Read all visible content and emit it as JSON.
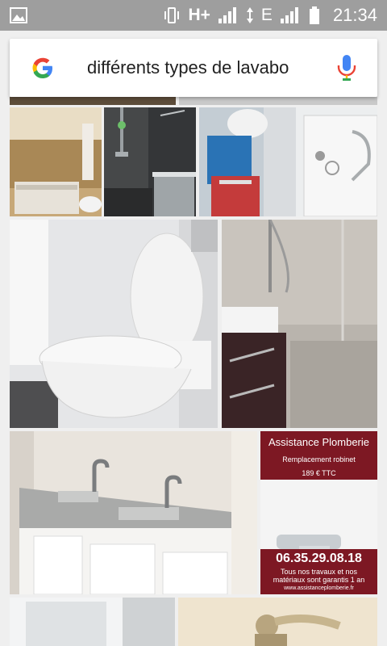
{
  "status_bar": {
    "icons": [
      "image-icon",
      "vibrate-icon",
      "signal-icon",
      "data-transfer-icon",
      "signal-icon",
      "battery-icon"
    ],
    "network_type_1": "H+",
    "network_type_2": "E",
    "time": "21:34"
  },
  "search": {
    "logo": "google-g-icon",
    "query": "différents types de lavabo",
    "mic_icon": "mic-icon"
  },
  "ad_tile": {
    "title": "Assistance Plomberie",
    "subtitle": "Remplacement robinet",
    "price": "189 € TTC",
    "phone": "06.35.29.08.18",
    "tagline_1": "Tous nos travaux et nos",
    "tagline_2": "matériaux sont garantis 1 an",
    "website": "www.assistanceplomberie.fr"
  },
  "colors": {
    "status_bar_bg": "#9e9e9e",
    "page_bg": "#efefef",
    "ad_red": "#7d1823",
    "google_blue": "#4285f4",
    "google_red": "#ea4335",
    "google_yellow": "#fbbc05",
    "google_green": "#34a853"
  }
}
